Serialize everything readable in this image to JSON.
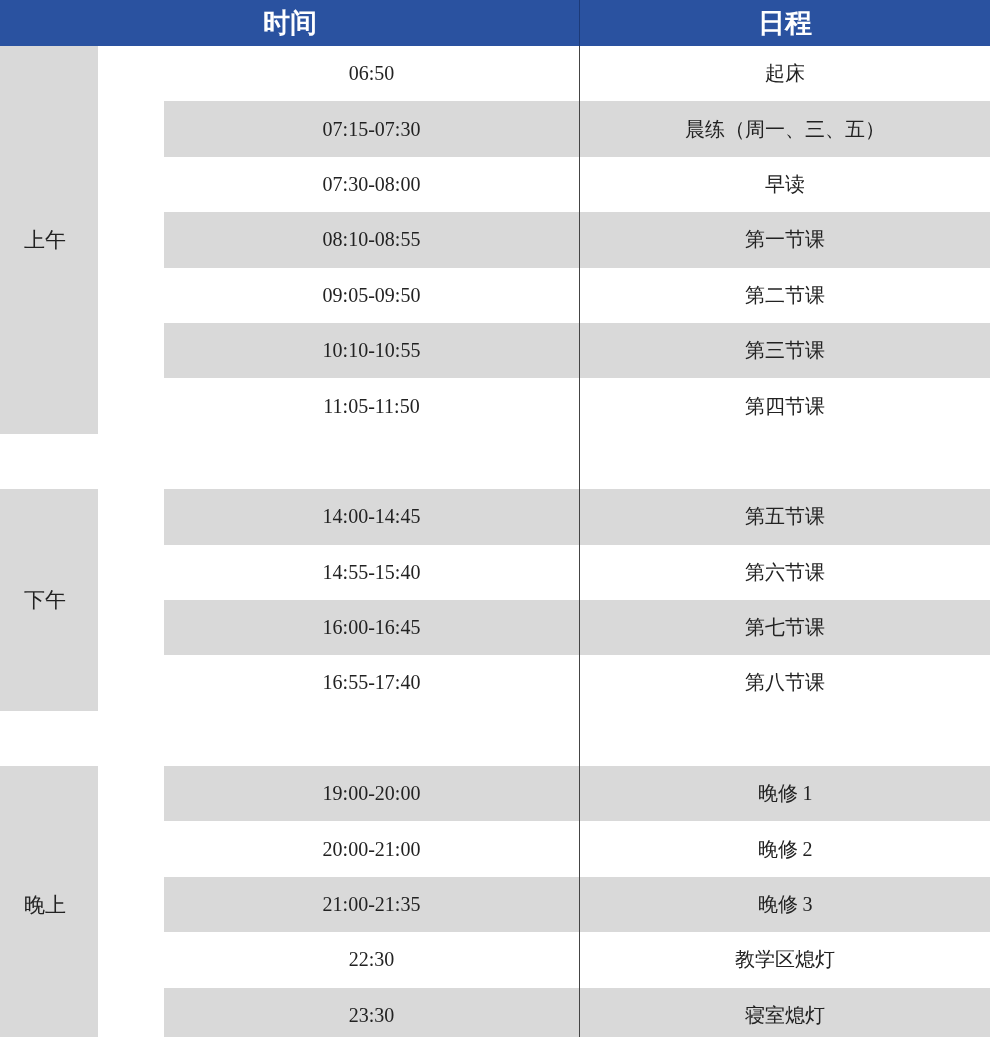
{
  "table": {
    "columns": [
      "时间",
      "日程"
    ],
    "groups": [
      {
        "period": "上午",
        "rows": [
          {
            "time": "06:50",
            "event": "起床",
            "shaded": false
          },
          {
            "time": "07:15-07:30",
            "event": "晨练（周一、三、五）",
            "shaded": true
          },
          {
            "time": "07:30-08:00",
            "event": "早读",
            "shaded": false
          },
          {
            "time": "08:10-08:55",
            "event": "第一节课",
            "shaded": true
          },
          {
            "time": "09:05-09:50",
            "event": "第二节课",
            "shaded": false
          },
          {
            "time": "10:10-10:55",
            "event": "第三节课",
            "shaded": true
          },
          {
            "time": "11:05-11:50",
            "event": "第四节课",
            "shaded": false
          }
        ]
      },
      {
        "period": "下午",
        "rows": [
          {
            "time": "14:00-14:45",
            "event": "第五节课",
            "shaded": true
          },
          {
            "time": "14:55-15:40",
            "event": "第六节课",
            "shaded": false
          },
          {
            "time": "16:00-16:45",
            "event": "第七节课",
            "shaded": true
          },
          {
            "time": "16:55-17:40",
            "event": "第八节课",
            "shaded": false
          }
        ]
      },
      {
        "period": "晚上",
        "rows": [
          {
            "time": "19:00-20:00",
            "event": "晚修 1",
            "shaded": true
          },
          {
            "time": "20:00-21:00",
            "event": "晚修 2",
            "shaded": false
          },
          {
            "time": "21:00-21:35",
            "event": "晚修 3",
            "shaded": true
          },
          {
            "time": "22:30",
            "event": "教学区熄灯",
            "shaded": false
          },
          {
            "time": "23:30",
            "event": "寝室熄灯",
            "shaded": true
          }
        ]
      }
    ]
  }
}
